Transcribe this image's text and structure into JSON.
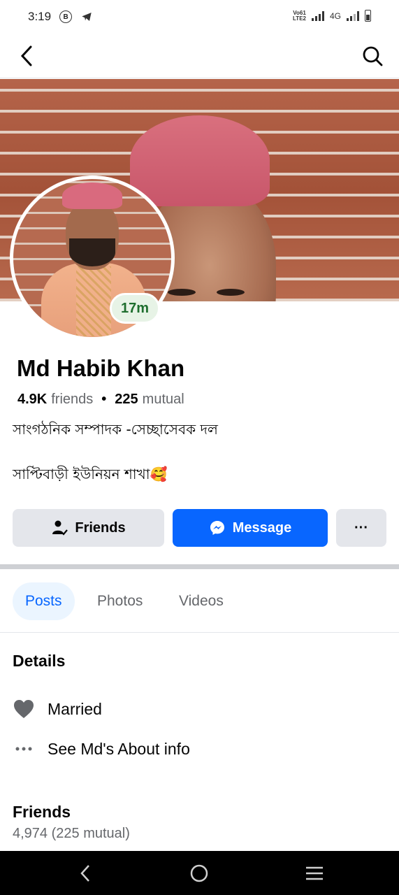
{
  "status_bar": {
    "time": "3:19",
    "b_icon_letter": "B",
    "network": "4G",
    "volte_top": "Vo61",
    "volte_bottom": "LTE2"
  },
  "profile": {
    "name": "Md Habib Khan",
    "friends_count": "4.9K",
    "friends_word": "friends",
    "mutual_count": "225",
    "mutual_word": "mutual",
    "active_badge": "17m",
    "bio_line1": "সাংগঠনিক সম্পাদক -সেচ্ছাসেবক দল",
    "bio_line2": "সাপ্টিবাড়ী ইউনিয়ন শাখা🥰"
  },
  "actions": {
    "friends_label": "Friends",
    "message_label": "Message",
    "more_label": "···"
  },
  "tabs": [
    {
      "label": "Posts",
      "active": true
    },
    {
      "label": "Photos",
      "active": false
    },
    {
      "label": "Videos",
      "active": false
    }
  ],
  "details": {
    "title": "Details",
    "relationship": "Married",
    "about_link": "See Md's About info"
  },
  "friends_section": {
    "title": "Friends",
    "summary": "4,974 (225 mutual)"
  },
  "colors": {
    "accent": "#0866ff",
    "button_gray": "#e4e6eb",
    "secondary_text": "#65676b",
    "active_green": "#1e6e2e"
  }
}
